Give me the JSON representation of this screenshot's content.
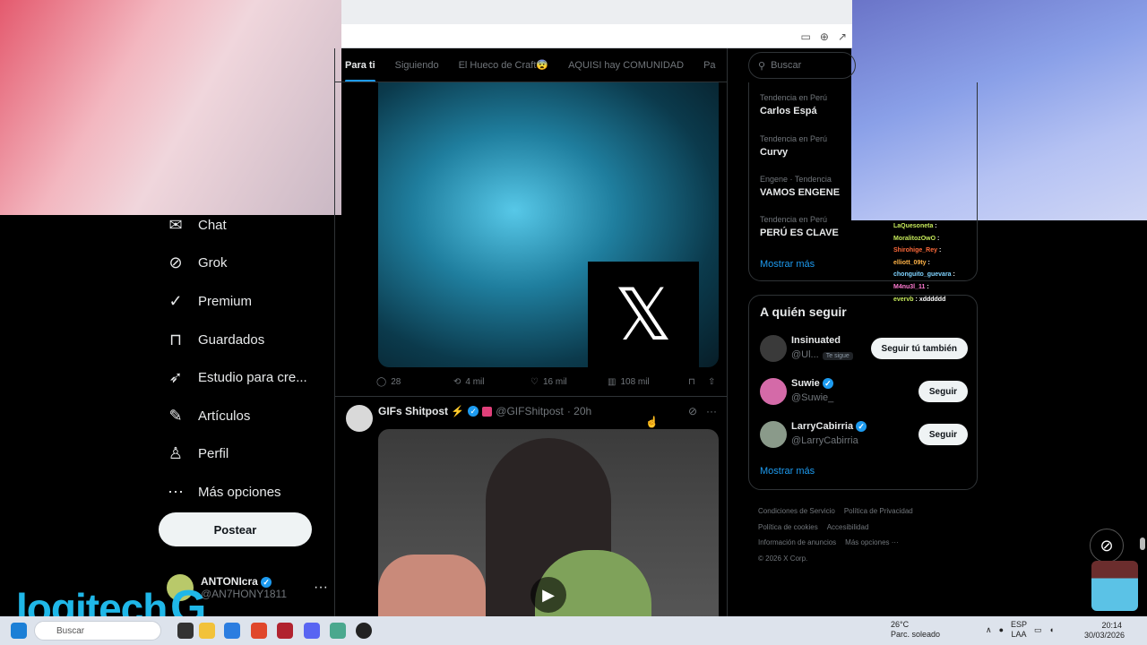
{
  "browser": {
    "icons": [
      "cast-icon",
      "zoom-icon",
      "share-icon"
    ]
  },
  "nav": {
    "items": [
      {
        "label": "Chat",
        "icon": "chat-icon"
      },
      {
        "label": "Grok",
        "icon": "grok-icon"
      },
      {
        "label": "Premium",
        "icon": "premium-icon"
      },
      {
        "label": "Guardados",
        "icon": "bookmark-icon"
      },
      {
        "label": "Estudio para cre...",
        "icon": "rocket-icon"
      },
      {
        "label": "Artículos",
        "icon": "article-icon"
      },
      {
        "label": "Perfil",
        "icon": "person-icon"
      },
      {
        "label": "Más opciones",
        "icon": "more-icon"
      }
    ],
    "post_label": "Postear",
    "account": {
      "name": "ANTONIcra",
      "handle": "@AN7HONY1811"
    }
  },
  "overlay": {
    "brand": "logitech",
    "brand_g": "G"
  },
  "feed": {
    "tabs": [
      "Para ti",
      "Siguiendo",
      "El Hueco de Craft😨",
      "AQUISI hay COMUNIDAD",
      "Pa"
    ],
    "active_tab": 0,
    "tweet1": {
      "stats": {
        "replies": "28",
        "reposts": "4 mil",
        "likes": "16 mil",
        "views": "108 mil"
      }
    },
    "tweet2": {
      "name": "GIFs Shitpost ⚡",
      "handle": "@GIFShitpost",
      "time": "· 20h"
    }
  },
  "right": {
    "search_placeholder": "Buscar",
    "trends": [
      {
        "context": "Tendencia en Perú",
        "name": "Carlos Espá"
      },
      {
        "context": "Tendencia en Perú",
        "name": "Curvy"
      },
      {
        "context": "Engene · Tendencia",
        "name": "VAMOS ENGENE"
      },
      {
        "context": "Tendencia en Perú",
        "name": "PERÚ ES CLAVE"
      }
    ],
    "trends_more": "Mostrar más",
    "who_title": "A quién seguir",
    "who": [
      {
        "name": "Insinuated",
        "handle": "@Ul...",
        "badge": "Te sigue",
        "button": "Seguir tú también",
        "color": "#3a3a3a"
      },
      {
        "name": "Suwie",
        "handle": "@Suwie_",
        "badge": "",
        "button": "Seguir",
        "color": "#d46aa8"
      },
      {
        "name": "LarryCabirria",
        "handle": "@LarryCabirria",
        "badge": "",
        "button": "Seguir",
        "color": "#8a9a8a"
      }
    ],
    "who_more": "Mostrar más",
    "footer": [
      "Condiciones de Servicio",
      "Política de Privacidad",
      "Política de cookies",
      "Accesibilidad",
      "Información de anuncios",
      "Más opciones ···",
      "© 2026 X Corp."
    ]
  },
  "stream_chat": [
    {
      "user": "LaQuesoneta",
      "msg": ""
    },
    {
      "user": "MoralitozOwO",
      "msg": ""
    },
    {
      "user": "Shirohige_Rey",
      "msg": ""
    },
    {
      "user": "elliott_09ty",
      "msg": ""
    },
    {
      "user": "chonguito_guevara",
      "msg": ""
    },
    {
      "user": "M4nu3l_11",
      "msg": ""
    },
    {
      "user": "evervb",
      "msg": "xdddddd"
    }
  ],
  "taskbar": {
    "search": "Buscar",
    "weather_temp": "26°C",
    "weather_desc": "Parc. soleado",
    "lang": "ESP",
    "lang_sub": "LAA",
    "time": "20:14",
    "date": "30/03/2026"
  }
}
